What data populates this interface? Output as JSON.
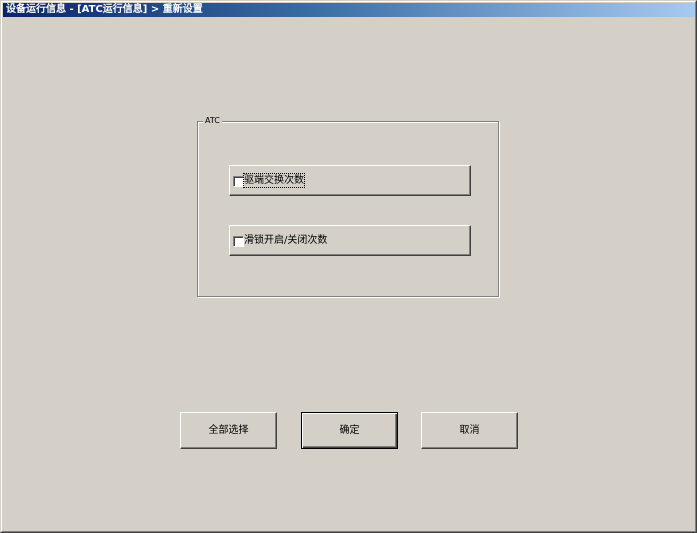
{
  "window": {
    "title": "设备运行信息 - [ATC运行信息] > 重新设置"
  },
  "group": {
    "legend": "ATC",
    "options": [
      {
        "label": "驱端交换次数",
        "checked": false,
        "focused": true
      },
      {
        "label": "滑锁开启/关闭次数",
        "checked": false,
        "focused": false
      }
    ]
  },
  "buttons": {
    "select_all": "全部选择",
    "ok": "确定",
    "cancel": "取消"
  }
}
